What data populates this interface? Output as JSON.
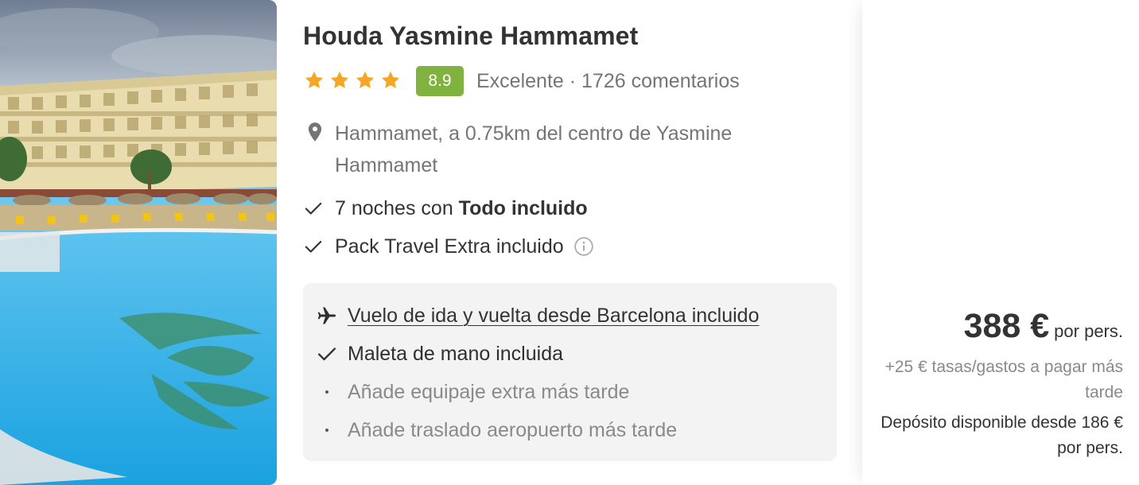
{
  "hotel": {
    "name": "Houda Yasmine Hammamet",
    "stars": 4,
    "score": "8.9",
    "rating_label": "Excelente · 1726 comentarios",
    "location": "Hammamet, a 0.75km del centro de Yasmine Hammamet"
  },
  "features": {
    "nights_prefix": "7 noches con ",
    "nights_bold": "Todo incluido",
    "pack": "Pack Travel Extra incluido"
  },
  "flight": {
    "link": "Vuelo de ida y vuelta desde Barcelona incluido",
    "hand_luggage": "Maleta de mano incluida",
    "extra_luggage": "Añade equipaje extra más tarde",
    "transfer": "Añade traslado aeropuerto más tarde"
  },
  "price": {
    "amount": "388 €",
    "per_person": "por pers.",
    "taxes": "+25 € tasas/gastos a pagar más tarde",
    "deposit": "Depósito disponible desde 186 € por pers."
  },
  "icons": {
    "star": "star-icon",
    "location": "location-pin-icon",
    "check": "check-icon",
    "info": "info-icon",
    "plane": "plane-icon"
  },
  "colors": {
    "star": "#f5a623",
    "score_badge": "#7fb23f",
    "muted_text": "#757575",
    "flight_box_bg": "#f3f3f3",
    "pool": "#2fb0e6"
  }
}
